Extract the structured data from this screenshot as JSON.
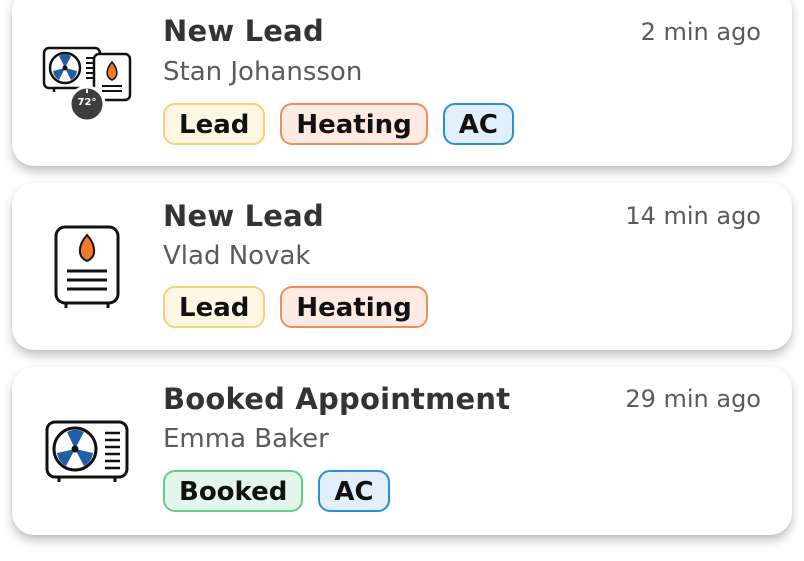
{
  "notifications": [
    {
      "icon": "ac-heater-thermostat-icon",
      "title": "New Lead",
      "name": "Stan Johansson",
      "time": "2 min ago",
      "thermostat_reading": "72°",
      "tags": [
        {
          "label": "Lead",
          "bg": "#fdf7e3",
          "border": "#f5d27a"
        },
        {
          "label": "Heating",
          "bg": "#fdebe3",
          "border": "#f08d5c"
        },
        {
          "label": "AC",
          "bg": "#e2f0fb",
          "border": "#2b8fd6"
        }
      ]
    },
    {
      "icon": "water-heater-icon",
      "title": "New Lead",
      "name": "Vlad Novak",
      "time": "14 min ago",
      "tags": [
        {
          "label": "Lead",
          "bg": "#fdf7e3",
          "border": "#f5d27a"
        },
        {
          "label": "Heating",
          "bg": "#fdebe3",
          "border": "#f08d5c"
        }
      ]
    },
    {
      "icon": "ac-unit-icon",
      "title": "Booked Appointment",
      "name": "Emma Baker",
      "time": "29 min ago",
      "tags": [
        {
          "label": "Booked",
          "bg": "#e4f6ea",
          "border": "#5ccf8a"
        },
        {
          "label": "AC",
          "bg": "#e2f0fb",
          "border": "#2b8fd6"
        }
      ]
    }
  ],
  "colors": {
    "fan_blue": "#1e5fa8",
    "flame_orange": "#f07a2a",
    "icon_stroke": "#111111"
  }
}
